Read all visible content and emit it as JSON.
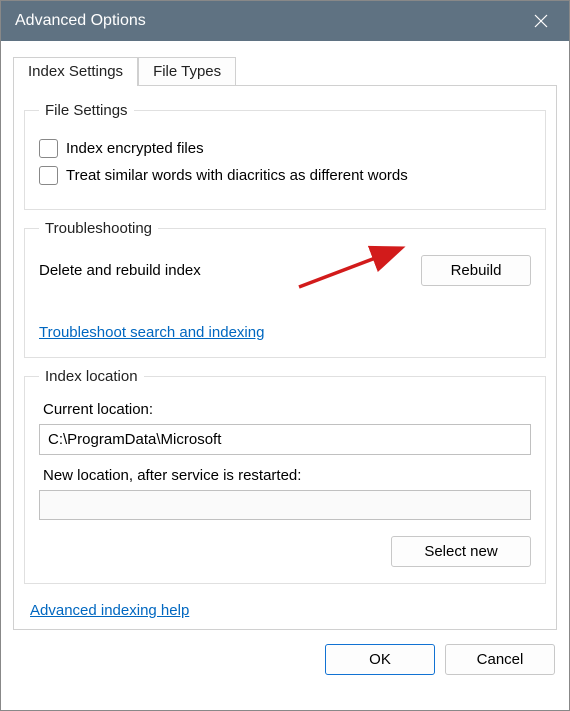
{
  "title": "Advanced Options",
  "tabs": {
    "index_settings": "Index Settings",
    "file_types": "File Types"
  },
  "file_settings": {
    "legend": "File Settings",
    "index_encrypted": "Index encrypted files",
    "treat_diacritics": "Treat similar words with diacritics as different words"
  },
  "troubleshooting": {
    "legend": "Troubleshooting",
    "delete_rebuild": "Delete and rebuild index",
    "rebuild_btn": "Rebuild",
    "troubleshoot_link": "Troubleshoot search and indexing"
  },
  "index_location": {
    "legend": "Index location",
    "current_label": "Current location:",
    "current_value": "C:\\ProgramData\\Microsoft",
    "new_label": "New location, after service is restarted:",
    "new_value": "",
    "select_new_btn": "Select new"
  },
  "footer": {
    "adv_help": "Advanced indexing help",
    "ok": "OK",
    "cancel": "Cancel"
  }
}
